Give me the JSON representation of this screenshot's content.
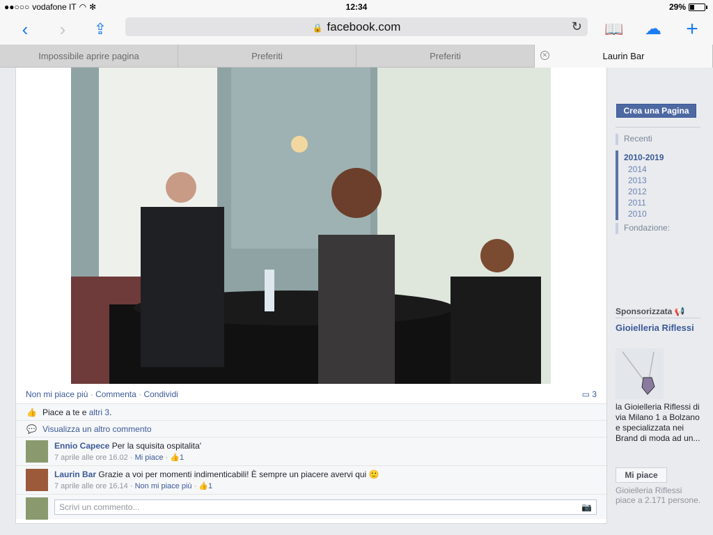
{
  "status": {
    "carrier": "vodafone IT",
    "time": "12:34",
    "battery": "29%"
  },
  "browser": {
    "url": "facebook.com",
    "tabs": [
      {
        "label": "Impossibile aprire pagina"
      },
      {
        "label": "Preferiti"
      },
      {
        "label": "Preferiti"
      },
      {
        "label": "Laurin Bar"
      }
    ]
  },
  "post": {
    "actions": {
      "unlike": "Non mi piace più",
      "comment": "Commenta",
      "share": "Condividi"
    },
    "comment_count": "3",
    "likes_text_prefix": "Piace a te e ",
    "likes_text_link": "altri 3",
    "likes_text_suffix": ".",
    "view_more": "Visualizza un altro commento",
    "comments": [
      {
        "author": "Ennio Capece",
        "text": "Per la squisita ospitalita'",
        "time": "7 aprile alle ore 16.02",
        "like_link": "Mi piace",
        "likes": "1"
      },
      {
        "author": "Laurin Bar",
        "text": "Grazie a voi per momenti indimenticabili! È sempre un piacere avervi qui",
        "time": "7 aprile alle ore 16.14",
        "like_link": "Non mi piace più",
        "likes": "1"
      }
    ],
    "write_placeholder": "Scrivi un commento..."
  },
  "sidebar": {
    "create_page": "Crea una Pagina",
    "timeline": {
      "recent": "Recenti",
      "decade": "2010-2019",
      "years": [
        "2014",
        "2013",
        "2012",
        "2011",
        "2010"
      ],
      "foundation": "Fondazione:"
    },
    "sponsored": {
      "header": "Sponsorizzata",
      "title": "Gioielleria Riflessi",
      "body": "la Gioielleria Riflessi di via Milano 1 a Bolzano e specializzata nei Brand di moda ad un...",
      "like_button": "Mi piace",
      "like_count": "Gioielleria Riflessi piace a 2.171 persone."
    }
  }
}
